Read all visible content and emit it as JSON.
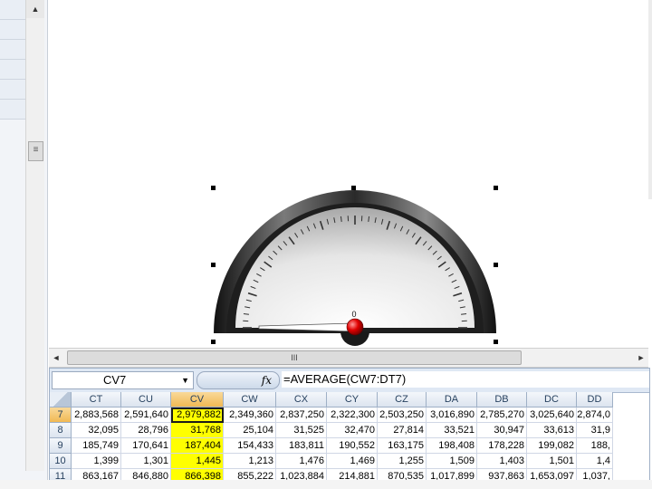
{
  "gauge": {
    "value_label": "0",
    "value": 0,
    "accent_color": "#cc0000"
  },
  "scrollbar": {
    "left_arrow": "◄",
    "right_arrow": "►",
    "up_arrow": "▲",
    "grip": "III",
    "vgrip": "≡"
  },
  "spreadsheet": {
    "name_box": "CV7",
    "name_dropdown": "▼",
    "fx_label": "fx",
    "formula": "=AVERAGE(CW7:DT7)",
    "highlight_color": "#ffff00",
    "columns": [
      "CT",
      "CU",
      "CV",
      "CW",
      "CX",
      "CY",
      "CZ",
      "DA",
      "DB",
      "DC",
      "DD"
    ],
    "rows": [
      {
        "num": "7",
        "cells": [
          "2,883,568",
          "2,591,640",
          "2,979,882",
          "2,349,360",
          "2,837,250",
          "2,322,300",
          "2,503,250",
          "3,016,890",
          "2,785,270",
          "3,025,640",
          "2,874,0"
        ]
      },
      {
        "num": "8",
        "cells": [
          "32,095",
          "28,796",
          "31,768",
          "25,104",
          "31,525",
          "32,470",
          "27,814",
          "33,521",
          "30,947",
          "33,613",
          "31,9"
        ]
      },
      {
        "num": "9",
        "cells": [
          "185,749",
          "170,641",
          "187,404",
          "154,433",
          "183,811",
          "190,552",
          "163,175",
          "198,408",
          "178,228",
          "199,082",
          "188,"
        ]
      },
      {
        "num": "10",
        "cells": [
          "1,399",
          "1,301",
          "1,445",
          "1,213",
          "1,476",
          "1,469",
          "1,255",
          "1,509",
          "1,403",
          "1,501",
          "1,4"
        ]
      },
      {
        "num": "11",
        "cells": [
          "863,167",
          "846,880",
          "866,398",
          "855,222",
          "1,023,884",
          "214,881",
          "870,535",
          "1,017,899",
          "937,863",
          "1,653,097",
          "1,037,"
        ]
      }
    ]
  }
}
